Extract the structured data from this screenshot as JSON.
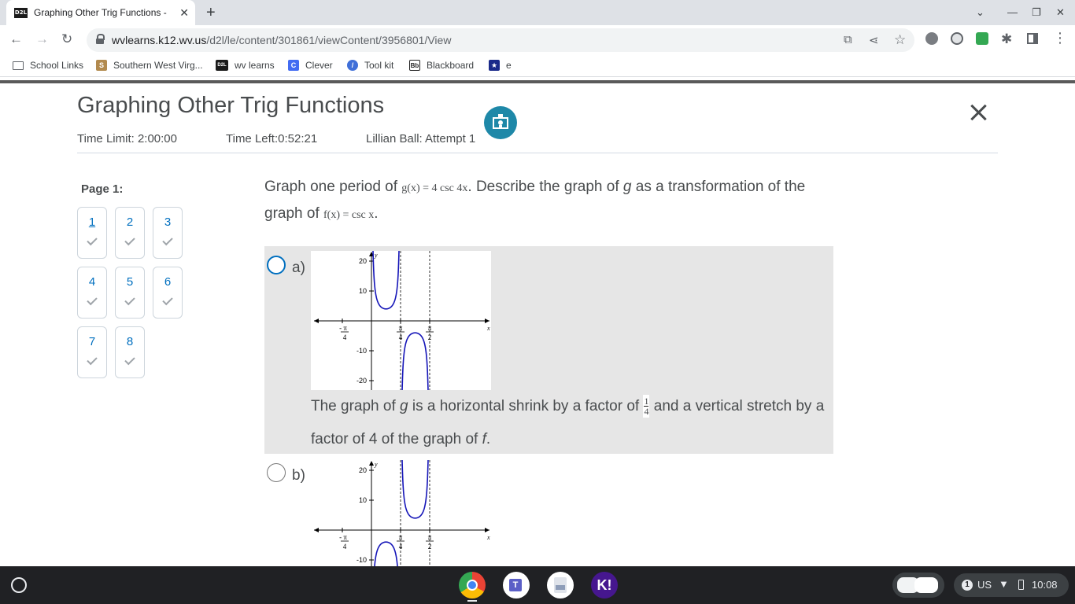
{
  "browser": {
    "tab_title": "Graphing Other Trig Functions - ",
    "tab_favicon": "D2L",
    "url_host": "wvlearns.k12.wv.us",
    "url_path": "/d2l/le/content/301861/viewContent/3956801/View",
    "bookmarks": [
      {
        "label": "School Links",
        "icon": "folder-icon"
      },
      {
        "label": "Southern West Virg...",
        "icon": "swv-icon"
      },
      {
        "label": "wv learns",
        "icon": "d2l-icon"
      },
      {
        "label": "Clever",
        "icon": "clever-icon"
      },
      {
        "label": "Tool kit",
        "icon": "toolkit-icon"
      },
      {
        "label": "Blackboard",
        "icon": "blackboard-icon"
      },
      {
        "label": "e",
        "icon": "star-badge-icon"
      }
    ]
  },
  "quiz": {
    "title": "Graphing Other Trig Functions",
    "time_limit": "Time Limit: 2:00:00",
    "time_left": "Time Left:0:52:21",
    "attempt": "Lillian Ball: Attempt 1",
    "page_label": "Page 1:",
    "questions": [
      "1",
      "2",
      "3",
      "4",
      "5",
      "6",
      "7",
      "8"
    ],
    "current_question": "1"
  },
  "question": {
    "prefix": "Graph one period of ",
    "g_def": "g(x) = 4 csc 4x",
    "middle": ". Describe the graph of ",
    "g": "g",
    "middle2": " as a transformation of the graph of ",
    "f_def": "f(x) = csc x",
    "end": "."
  },
  "options": [
    {
      "label": "a)",
      "desc_part1": "The graph of ",
      "desc_g": "g",
      "desc_part2": " is a horizontal shrink by a factor of ",
      "frac_num": "1",
      "frac_den": "4",
      "desc_part3": " and a vertical stretch by a factor of 4 of the graph of ",
      "desc_f": "f",
      "desc_end": ".",
      "graph": {
        "y_ticks": [
          "20",
          "10",
          "-10",
          "-20"
        ],
        "x_ticks": [
          "-π/4",
          "π/4",
          "π/2"
        ],
        "x_label": "x",
        "y_label": "y"
      }
    },
    {
      "label": "b)",
      "graph": {
        "y_ticks": [
          "20",
          "10",
          "-10"
        ],
        "x_ticks": [
          "-π/4",
          "π/4",
          "π/2"
        ],
        "x_label": "x",
        "y_label": "y"
      }
    }
  ],
  "taskbar": {
    "notification_count": "1",
    "keyboard": "US",
    "time": "10:08"
  },
  "colors": {
    "accent": "#006fbf",
    "tools_button": "#1e88a8",
    "curve": "#1515b8",
    "selected_bg": "#e6e6e6"
  }
}
